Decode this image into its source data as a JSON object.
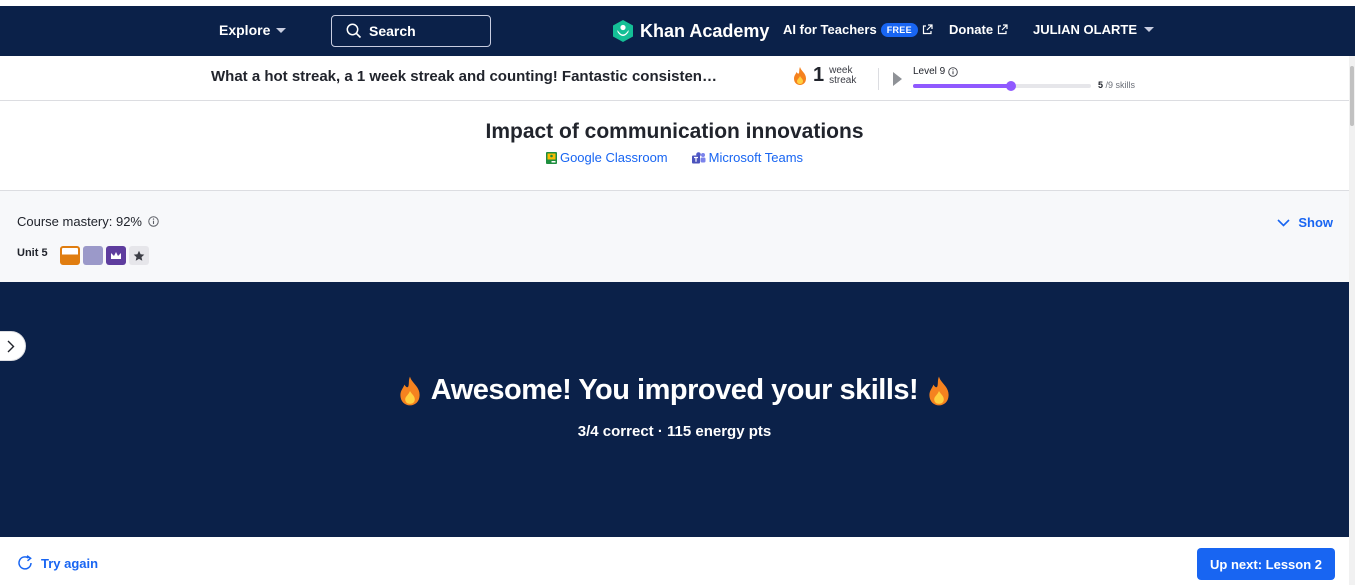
{
  "nav": {
    "explore": "Explore",
    "search_label": "Search",
    "logo": "Khan Academy",
    "ai_teachers": "AI for Teachers",
    "free_badge": "FREE",
    "donate": "Donate",
    "user": "JULIAN OLARTE"
  },
  "streak": {
    "message": "What a hot streak, a 1 week streak and counting! Fantastic consisten…",
    "count": "1",
    "unit_line1": "week",
    "unit_line2": "streak",
    "level": "Level 9",
    "skills_done": "5",
    "skills_total": "/9 skills",
    "progress_fraction": 0.555
  },
  "lesson": {
    "title": "Impact of communication innovations",
    "google": "Google Classroom",
    "teams": "Microsoft Teams"
  },
  "mastery": {
    "label": "Course mastery: 92%",
    "show": "Show",
    "unit": "Unit 5",
    "blocks": [
      "familiar",
      "proficient",
      "mastered",
      "unit-test"
    ]
  },
  "result": {
    "headline": "Awesome! You improved your skills!",
    "summary": "3/4 correct · 115 energy pts"
  },
  "footer": {
    "try_again": "Try again",
    "up_next": "Up next: Lesson 2"
  },
  "colors": {
    "nav_bg": "#0b2149",
    "accent": "#1865f2",
    "level_purple": "#9059ff",
    "familiar": "#e07d10",
    "proficient": "#9b99c9",
    "mastered": "#5e3d9e"
  }
}
